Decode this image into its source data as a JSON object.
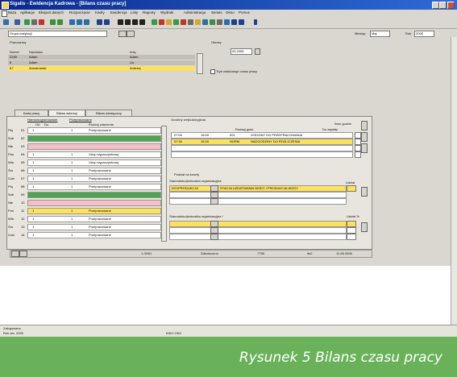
{
  "window": {
    "title": "Sigalis - Ewidencja Kadrowa - [Bilans czasu pracy]",
    "logo": "doc-icon"
  },
  "menu": [
    "Baza",
    "Aplikacje",
    "Eksport danych",
    "Rozpoczęcie",
    "Kadry",
    "Ewidencja",
    "Listy",
    "Raporty",
    "Wydruki",
    "Administracja",
    "Serwis",
    "Okno",
    "Pomoc"
  ],
  "filters": {
    "group_label": "Grupa instytucji",
    "month_label": "Miesiąc",
    "month_value": "Maj",
    "year_label": "Rok",
    "year_value": "2005"
  },
  "employees": {
    "title": "Pracownicy",
    "headers": [
      "Numer",
      "Nazwisko",
      "Imię"
    ],
    "rows": [
      {
        "num": "2245",
        "surname": "Adam",
        "name": "Adam"
      },
      {
        "num": "6",
        "surname": "Adam",
        "name": "Lis"
      },
      {
        "num": "87",
        "surname": "Anwarowski",
        "name": "Andrzej"
      }
    ]
  },
  "period": {
    "title": "Okresy",
    "date_value": "05.2005",
    "checkbox_label": "Tryb ustalonego czasu pracy"
  },
  "tabs": [
    "Karta pracy",
    "Bilans dzienny",
    "Bilans miesięczny"
  ],
  "calendar": {
    "header_schedule": "Harmonogramowane",
    "header_worked": "Przepracowane",
    "col_from": "Od",
    "col_to": "Do",
    "col_type": "Rodzaj zdarzenia",
    "rows": [
      {
        "day": "Pią",
        "num": "01",
        "code": "1",
        "desc": "Przepracowane",
        "color": "#ffffff"
      },
      {
        "day": "Sob",
        "num": "02",
        "code": "",
        "desc": "",
        "color": "#4fa44f"
      },
      {
        "day": "Nie",
        "num": "03",
        "code": "",
        "desc": "",
        "color": "#f4bfc6"
      },
      {
        "day": "Pon",
        "num": "04",
        "code": "1",
        "desc": "Urlop wypoczynkowy",
        "color": "#ffffff"
      },
      {
        "day": "Wto",
        "num": "05",
        "code": "1",
        "desc": "Urlop wypoczynkowy",
        "color": "#ffffff"
      },
      {
        "day": "Śro",
        "num": "06",
        "code": "1",
        "desc": "Przepracowane",
        "color": "#ffffff"
      },
      {
        "day": "Czw",
        "num": "07",
        "code": "1",
        "desc": "Przepracowane",
        "color": "#ffffff"
      },
      {
        "day": "Pią",
        "num": "08",
        "code": "1",
        "desc": "Przepracowane",
        "color": "#ffffff"
      },
      {
        "day": "Sob",
        "num": "09",
        "code": "",
        "desc": "",
        "color": "#4fa44f"
      },
      {
        "day": "Nie",
        "num": "10",
        "code": "",
        "desc": "",
        "color": "#f4bfc6"
      },
      {
        "day": "Pon",
        "num": "11",
        "code": "1",
        "desc": "Przepracowane",
        "color": "#ffe15a"
      },
      {
        "day": "Wto",
        "num": "12",
        "code": "1",
        "desc": "Przepracowane",
        "color": "#ffffff"
      },
      {
        "day": "Śro",
        "num": "13",
        "code": "1",
        "desc": "Przepracowane",
        "color": "#ffffff"
      },
      {
        "day": "Czw",
        "num": "14",
        "code": "1",
        "desc": "Przepracowane",
        "color": "#ffffff"
      }
    ]
  },
  "events": {
    "title": "Godziny wejścia/wyjścia",
    "col_in_out": "Rodzaj godz.",
    "rows": [
      {
        "time_in": "07:00",
        "time_out": "15:00",
        "code": "001",
        "desc": "GODZINY DO PRZEPRACOWANIA",
        "color": "#ffffff"
      },
      {
        "time_in": "07:30",
        "time_out": "15:30",
        "code": "NORM",
        "desc": "NADGODZINY DO ROZLICZENIA",
        "color": "#ffe15a"
      }
    ],
    "extra_label": "Ilość godzin",
    "extra_sub": "Do zapłaty"
  },
  "structure": {
    "title": "Podział na koszty",
    "row_label": "Stanowisko/jednostka organizacyjna",
    "row_value": "DO1PRODUKCJA",
    "row_desc": "STACJA UZDATNIANIA WODY I PRODUKCJA WODY",
    "second_label": "Stanowisko/jednostka organizacyjna *",
    "share_label": "Udział",
    "share_label2": "Udział %"
  },
  "status": {
    "left": "1 /2051",
    "mid": "Zakończono",
    "code": "7758",
    "right_label": "ds2",
    "date": "11.05.2005"
  },
  "bottom": {
    "line1": "Zalogowano",
    "line2": "Rok obr. 2005",
    "center": "ЮКО ОКО"
  },
  "caption": "Rysunek 5 Bilans czasu pracy",
  "colors": {
    "title_start": "#0a2a8c",
    "title_end": "#2f6bd6",
    "highlight": "#ffe15a",
    "weekend_sat": "#4fa44f",
    "weekend_sun": "#f4bfc6",
    "caption_bg": "#6ab25a"
  }
}
